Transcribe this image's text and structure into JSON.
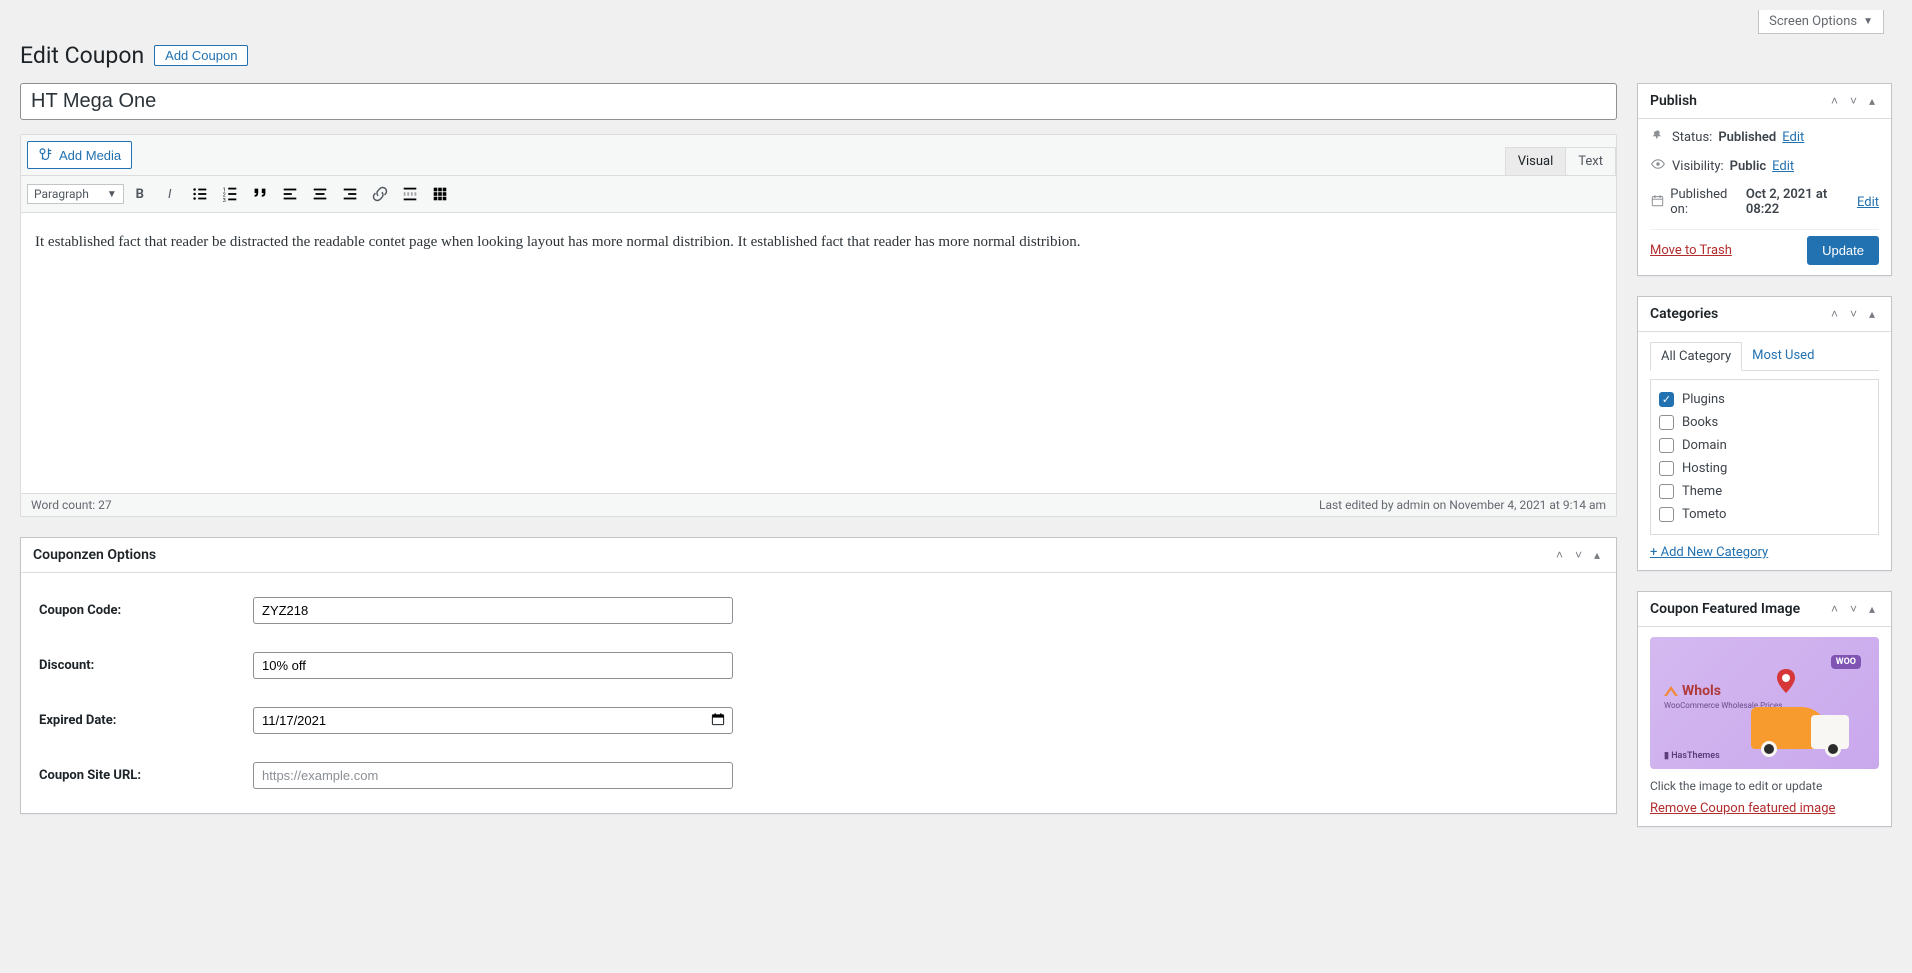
{
  "screen_options": "Screen Options",
  "page_title": "Edit Coupon",
  "add_new_label": "Add Coupon",
  "title_value": "HT Mega One",
  "editor": {
    "add_media": "Add Media",
    "tab_visual": "Visual",
    "tab_text": "Text",
    "format_select": "Paragraph",
    "content": "It established fact that reader be distracted the readable contet page when looking layout has more normal distribion. It established fact that reader has more normal distribion.",
    "word_count_label": "Word count: 27",
    "last_edited": "Last edited by admin on November 4, 2021 at 9:14 am"
  },
  "options_box": {
    "heading": "Couponzen Options",
    "coupon_code_label": "Coupon Code:",
    "coupon_code_value": "ZYZ218",
    "discount_label": "Discount:",
    "discount_value": "10% off",
    "expired_label": "Expired Date:",
    "expired_value": "11/17/2021",
    "site_url_label": "Coupon Site URL:",
    "site_url_placeholder": "https://example.com"
  },
  "publish": {
    "heading": "Publish",
    "status_label": "Status:",
    "status_value": "Published",
    "visibility_label": "Visibility:",
    "visibility_value": "Public",
    "published_on_label": "Published on:",
    "published_on_value": "Oct 2, 2021 at 08:22",
    "edit_label": "Edit",
    "trash_label": "Move to Trash",
    "update_label": "Update"
  },
  "categories": {
    "heading": "Categories",
    "tab_all": "All Category",
    "tab_most": "Most Used",
    "items": [
      {
        "label": "Plugins",
        "checked": true
      },
      {
        "label": "Books",
        "checked": false
      },
      {
        "label": "Domain",
        "checked": false
      },
      {
        "label": "Hosting",
        "checked": false
      },
      {
        "label": "Theme",
        "checked": false
      },
      {
        "label": "Tometo",
        "checked": false
      }
    ],
    "add_new": "+ Add New Category"
  },
  "featured": {
    "heading": "Coupon Featured Image",
    "brand": "Whols",
    "subtitle": "WooCommerce Wholesale Prices",
    "woo_badge": "WOO",
    "footer_brand": "▮ HasThemes",
    "hint": "Click the image to edit or update",
    "remove": "Remove Coupon featured image"
  }
}
